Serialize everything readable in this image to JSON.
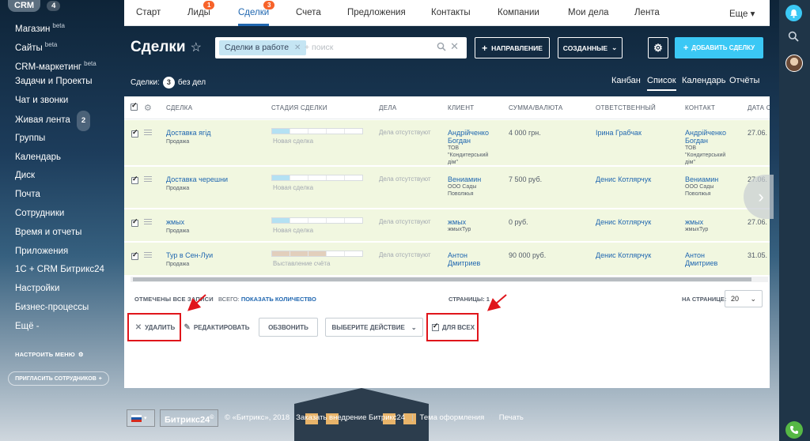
{
  "sidebar": {
    "crm_label": "CRM",
    "crm_count": "4",
    "items": [
      {
        "label": "Магазин",
        "sup": "beta"
      },
      {
        "label": "Сайты",
        "sup": "beta"
      },
      {
        "label": "CRM-маркетинг",
        "sup": "beta"
      },
      {
        "label": "Задачи и Проекты"
      },
      {
        "label": "Чат и звонки"
      },
      {
        "label": "Живая лента",
        "badge": "2"
      },
      {
        "label": "Группы"
      },
      {
        "label": "Календарь"
      },
      {
        "label": "Диск"
      },
      {
        "label": "Почта"
      },
      {
        "label": "Сотрудники"
      },
      {
        "label": "Время и отчеты"
      },
      {
        "label": "Приложения"
      },
      {
        "label": "1С + CRM Битрикс24"
      },
      {
        "label": "Настройки"
      },
      {
        "label": "Бизнес-процессы"
      },
      {
        "label": "Ещё -"
      }
    ],
    "setup_menu": "НАСТРОИТЬ МЕНЮ",
    "invite": "ПРИГЛАСИТЬ СОТРУДНИКОВ"
  },
  "topnav": {
    "items": [
      {
        "label": "Старт"
      },
      {
        "label": "Лиды",
        "count": "1"
      },
      {
        "label": "Сделки",
        "count": "3",
        "active": true
      },
      {
        "label": "Счета"
      },
      {
        "label": "Предложения"
      },
      {
        "label": "Контакты"
      },
      {
        "label": "Компании"
      },
      {
        "label": "Мои дела"
      },
      {
        "label": "Лента"
      }
    ],
    "more": "Еще ▾"
  },
  "header": {
    "title": "Сделки",
    "star": "☆",
    "filter_chip": "Сделки в работе",
    "search_placeholder": "+ поиск",
    "direction_btn": "НАПРАВЛЕНИЕ",
    "created_btn": "СОЗДАННЫЕ",
    "add_btn": "ДОБАВИТЬ СДЕЛКУ"
  },
  "subheader": {
    "deals_label": "Сделки:",
    "deals_count": "3",
    "no_tasks": "без дел",
    "views": [
      "Канбан",
      "Список",
      "Календарь",
      "Отчёты"
    ],
    "active_view": "Список"
  },
  "grid": {
    "columns": [
      "СДЕЛКА",
      "СТАДИЯ СДЕЛКИ",
      "ДЕЛА",
      "КЛИЕНТ",
      "СУММА/ВАЛЮТА",
      "ОТВЕТСТВЕННЫЙ",
      "КОНТАКТ",
      "ДАТА С"
    ],
    "rows": [
      {
        "deal": "Доставка ягід",
        "type": "Продажа",
        "stage": "Новая сделка",
        "stage_fill": 1,
        "stage_color": "#b4e1f3",
        "tasks": "Дела отсутствуют",
        "client": [
          "Андрійченко",
          "Богдан"
        ],
        "client_sub": [
          "ТОВ",
          "\"Кондитерський",
          "дім\""
        ],
        "amount": "4 000 грн.",
        "responsible": "Ірина Грабчак",
        "contact": [
          "Андрійченко",
          "Богдан"
        ],
        "contact_sub": [
          "ТОВ",
          "\"Кондитерський",
          "дім\""
        ],
        "date": "27.06."
      },
      {
        "deal": "Доставка черешни",
        "type": "Продажа",
        "stage": "Новая сделка",
        "stage_fill": 1,
        "stage_color": "#b4e1f3",
        "tasks": "Дела отсутствуют",
        "client": [
          "Вениамин"
        ],
        "client_sub": [
          "ООО Сады",
          "Поволжья"
        ],
        "amount": "7 500 руб.",
        "responsible": "Денис Котлярчук",
        "contact": [
          "Вениамин"
        ],
        "contact_sub": [
          "ООО Сады",
          "Поволжья"
        ],
        "date": "27.06."
      },
      {
        "deal": "жмых",
        "type": "Продажа",
        "stage": "Новая сделка",
        "stage_fill": 1,
        "stage_color": "#b4e1f3",
        "tasks": "Дела отсутствуют",
        "client": [
          "жмых"
        ],
        "client_sub": [
          "жмыхТур"
        ],
        "amount": "0 руб.",
        "responsible": "Денис Котлярчук",
        "contact": [
          "жмых"
        ],
        "contact_sub": [
          "жмыхТур"
        ],
        "date": "27.06."
      },
      {
        "deal": "Тур в Сен-Луи",
        "type": "Продажа",
        "stage": "Выставление счёта",
        "stage_fill": 3,
        "stage_color": "#e2cfbc",
        "tasks": "Дела отсутствуют",
        "client": [
          "Антон",
          "Дмитриев"
        ],
        "client_sub": [],
        "amount": "90 000 руб.",
        "responsible": "Денис Котлярчук",
        "contact": [
          "Антон",
          "Дмитриев"
        ],
        "contact_sub": [],
        "date": "31.05."
      }
    ]
  },
  "footer": {
    "selected_all": "ОТМЕЧЕНЫ ВСЕ ЗАПИСИ",
    "total_label": "ВСЕГО:",
    "total_link": "ПОКАЗАТЬ КОЛИЧЕСТВО",
    "pages": "СТРАНИЦЫ: 1",
    "per_page_label": "НА СТРАНИЦЕ:",
    "per_page_value": "20",
    "delete": "УДАЛИТЬ",
    "edit": "РЕДАКТИРОВАТЬ",
    "call": "ОБЗВОНИТЬ",
    "choose_action": "ВЫБЕРИТЕ ДЕЙСТВИЕ",
    "for_all": "ДЛЯ ВСЕХ"
  },
  "bottombar": {
    "lang": "ru",
    "brand": "Битрикс24",
    "brand_mark": "©",
    "copyright": "© «Битрикс», 2018",
    "order": "Заказать внедрение Битрикс24",
    "theme": "Тема оформления",
    "print": "Печать"
  },
  "colors": {
    "accent": "#2067b0",
    "add_button": "#3bc8f5",
    "selected_row": "#f1f7e0",
    "counter": "#f7632a",
    "annotation": "#e0151b"
  }
}
